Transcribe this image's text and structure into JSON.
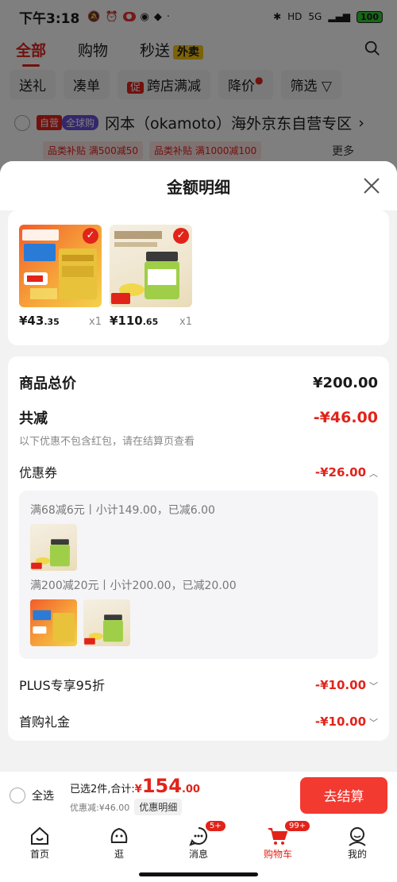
{
  "status": {
    "time": "下午3:18",
    "battery": "100",
    "network": "5G"
  },
  "tabs": {
    "all": "全部",
    "shop": "购物",
    "flash": "秒送",
    "waimai": "外卖"
  },
  "filters": [
    "送礼",
    "凑单",
    "跨店满减",
    "降价",
    "筛选"
  ],
  "filter_promo": "促",
  "store": {
    "tag_self": "自营",
    "tag_global": "全球购",
    "name": "冈本（okamoto）海外京东自营专区"
  },
  "subsidies": [
    "品类补贴 满500减50",
    "品类补贴 满1000减100"
  ],
  "more": "更多",
  "sheet": {
    "title": "金额明细",
    "items": [
      {
        "int": "¥43",
        "dec": ".35",
        "qty": "x1"
      },
      {
        "int": "¥110",
        "dec": ".65",
        "qty": "x1"
      }
    ],
    "total_label": "商品总价",
    "total_value": "¥200.00",
    "reduce_label": "共减",
    "reduce_value": "-¥46.00",
    "note": "以下优惠不包含红包，请在结算页查看",
    "coupon_label": "优惠券",
    "coupon_value": "-¥26.00",
    "coupon_line1": "满68减6元丨小计149.00，已减6.00",
    "coupon_line2": "满200减20元丨小计200.00，已减20.00",
    "plus_label": "PLUS专享95折",
    "plus_value": "-¥10.00",
    "first_label": "首购礼金",
    "first_value": "-¥10.00"
  },
  "checkout": {
    "select_all": "全选",
    "selected": "已选2件,合计:",
    "currency": "¥",
    "big": "154",
    "dec": ".00",
    "saved": "优惠减:¥46.00",
    "detail": "优惠明细",
    "button": "去结算"
  },
  "nav": {
    "items": [
      {
        "label": "首页"
      },
      {
        "label": "逛"
      },
      {
        "label": "消息",
        "badge": "5+"
      },
      {
        "label": "购物车",
        "badge": "99+"
      },
      {
        "label": "我的"
      }
    ]
  },
  "colors": {
    "accent": "#e2231a",
    "button": "#f23a31"
  }
}
